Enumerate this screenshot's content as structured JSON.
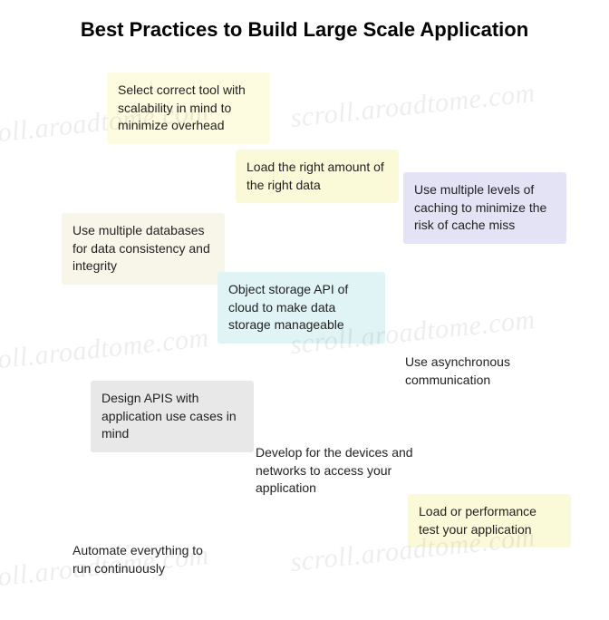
{
  "title": "Best Practices to Build Large Scale Application",
  "notes": {
    "select_tool": "Select correct tool with scalability in mind to minimize overhead",
    "load_data": "Load the right amount of the right data",
    "caching": "Use multiple levels of caching to minimize the risk of cache miss",
    "databases": "Use multiple databases for data consistency and integrity",
    "object_storage": "Object storage API of cloud to make data storage manageable",
    "async_comm": "Use asynchronous communication",
    "design_apis": "Design APIS with application use cases in mind",
    "develop_devices": "Develop for the devices and networks to access your application",
    "load_test": "Load or performance test your application",
    "automate": "Automate everything to run continuously"
  },
  "watermark": "scroll.aroadtome.com"
}
